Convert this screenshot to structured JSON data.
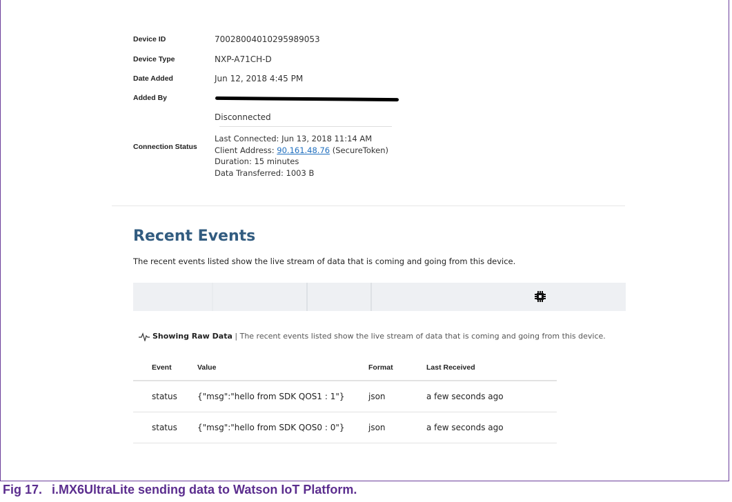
{
  "device": {
    "id_label": "Device ID",
    "id_value": "70028004010295989053",
    "type_label": "Device Type",
    "type_value": "NXP-A71CH-D",
    "date_label": "Date Added",
    "date_value": "Jun 12, 2018 4:45 PM",
    "added_by_label": "Added By",
    "connection_label": "Connection Status",
    "connection_state": "Disconnected",
    "last_connected": "Last Connected: Jun 13, 2018 11:14 AM",
    "client_address_prefix": "Client Address: ",
    "client_address_link": "90.161.48.76",
    "client_address_suffix": " (SecureToken)",
    "duration": "Duration: 15 minutes",
    "data_transferred": "Data Transferred: 1003 B"
  },
  "events": {
    "title": "Recent Events",
    "description": "The recent events listed show the live stream of data that is coming and going from this device.",
    "raw_label": "Showing Raw Data",
    "raw_description": " | The recent events listed show the live stream of data that is coming and going from this device.",
    "columns": [
      "Event",
      "Value",
      "Format",
      "Last Received"
    ],
    "rows": [
      {
        "event": "status",
        "value": "{\"msg\":\"hello from SDK QOS1 : 1\"}",
        "format": "json",
        "received": "a few seconds ago"
      },
      {
        "event": "status",
        "value": "{\"msg\":\"hello from SDK QOS0 : 0\"}",
        "format": "json",
        "received": "a few seconds ago"
      }
    ]
  },
  "caption": {
    "number": "Fig 17.",
    "text": "i.MX6UltraLite sending data to Watson IoT Platform."
  },
  "colors": {
    "heading": "#325c80",
    "frame": "#6a3d9a",
    "caption": "#5b2d8e",
    "link": "#1f6fbf"
  },
  "icons": [
    "chip-icon",
    "pulse-icon"
  ]
}
